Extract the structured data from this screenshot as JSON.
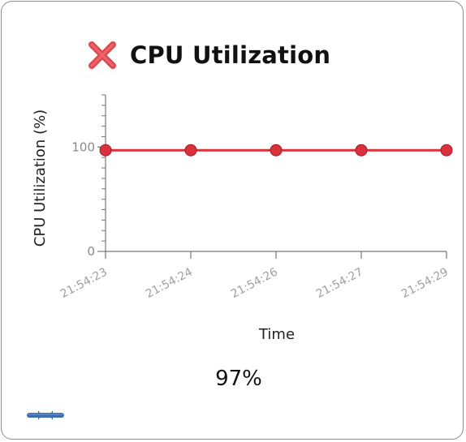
{
  "widget": {
    "title": "CPU Utilization",
    "status_icon": "error-x-icon",
    "status_color": "#e0484e",
    "value_text": "97%",
    "handle_icon": "drag-handle-icon",
    "handle_color": "#3d6db0"
  },
  "chart_data": {
    "type": "line",
    "title": "CPU Utilization",
    "xlabel": "Time",
    "ylabel": "CPU Utilization (%)",
    "x": [
      "21:54:23",
      "21:54:24",
      "21:54:26",
      "21:54:27",
      "21:54:29"
    ],
    "series": [
      {
        "values": [
          97,
          97,
          97,
          97,
          97
        ],
        "color": "#d9323c"
      }
    ],
    "ylim": [
      0,
      150
    ],
    "yticks": [
      0,
      100
    ],
    "grid": false,
    "legend": "none"
  }
}
